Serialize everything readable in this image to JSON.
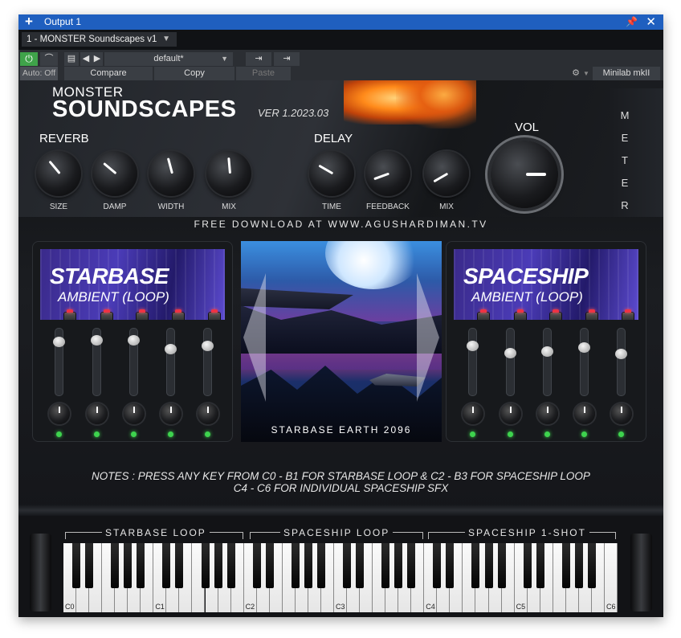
{
  "window": {
    "title": "Output 1",
    "pin_icon": "pin-icon",
    "close_icon": "close-icon"
  },
  "preset_tab": {
    "label": "1 - MONSTER Soundscapes v1"
  },
  "toolbar": {
    "auto_label": "Auto: Off",
    "preset_value": "default*",
    "compare_label": "Compare",
    "copy_label": "Copy",
    "paste_label": "Paste",
    "device_label": "Minilab mkII"
  },
  "plugin": {
    "brand_top": "MONSTER",
    "brand_main": "SOUNDSCAPES",
    "version": "VER 1.2023.03",
    "reverb": {
      "title": "REVERB",
      "knobs": [
        "SIZE",
        "DAMP",
        "WIDTH",
        "MIX"
      ]
    },
    "delay": {
      "title": "DELAY",
      "knobs": [
        "TIME",
        "FEEDBACK",
        "MIX"
      ]
    },
    "vol_label": "VOL",
    "meter_label": "METER",
    "banner": "FREE DOWNLOAD AT WWW.AGUSHARDIMAN.TV",
    "left_panel": {
      "title": "STARBASE",
      "subtitle": "AMBIENT (LOOP)",
      "slider_levels": [
        0.85,
        0.88,
        0.88,
        0.72,
        0.78
      ]
    },
    "right_panel": {
      "title": "SPACESHIP",
      "subtitle": "AMBIENT (LOOP)",
      "slider_levels": [
        0.78,
        0.65,
        0.68,
        0.75,
        0.64
      ]
    },
    "center_caption": "STARBASE EARTH 2096",
    "notes_line1": "NOTES : PRESS ANY KEY FROM C0 - B1 FOR STARBASE LOOP & C2 - B3 FOR SPACESHIP LOOP",
    "notes_line2": "C4 - C6 FOR INDIVIDUAL SPACESHIP SFX"
  },
  "keyboard": {
    "sections": [
      "STARBASE LOOP",
      "SPACESHIP LOOP",
      "SPACESHIP 1-SHOT"
    ],
    "octave_labels": [
      "C0",
      "C1",
      "C2",
      "C3",
      "C4",
      "C5",
      "C6"
    ]
  }
}
